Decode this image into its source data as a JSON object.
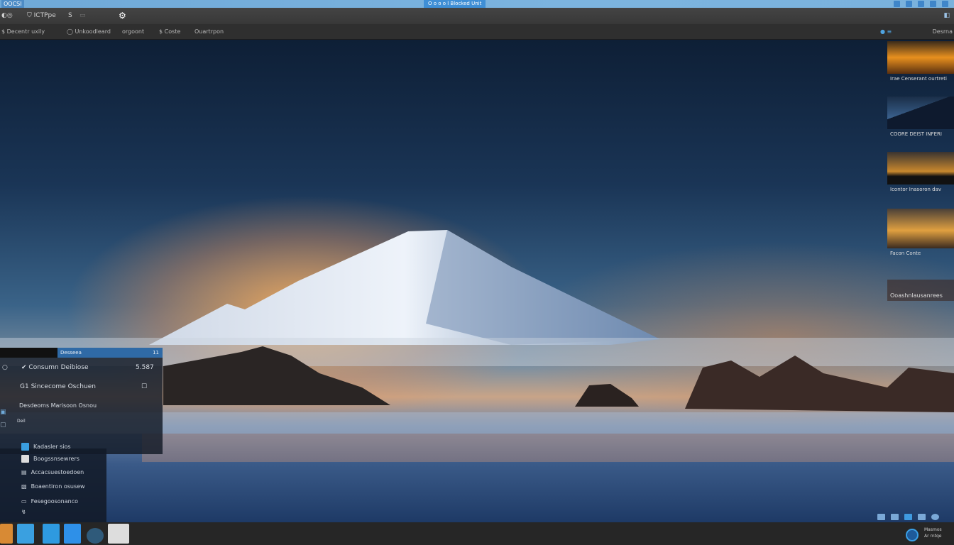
{
  "titlebar": {
    "title": "OOCSI",
    "center": "O o o o l Blocked Unit"
  },
  "toolbar": {
    "item1": "ICTPpe",
    "item2": "S"
  },
  "nav": {
    "items": [
      "Decentr uxily",
      "Unkoodleard",
      "orgoont",
      "Coste",
      "Ouartrpon"
    ],
    "right": "Desrna"
  },
  "thumbnails": [
    {
      "label": "Irae Censerant ourtreti"
    },
    {
      "label": "COORE DEIST INFERI"
    },
    {
      "label": "Icontor Inasoron dav"
    },
    {
      "label": "Facon Conte"
    },
    {
      "label": "Ooashnlausanrees"
    }
  ],
  "panel": {
    "header": "Desseea",
    "header_num": "11",
    "rows": [
      {
        "label": "Consumn Deibiose",
        "value": "5.587"
      },
      {
        "label": "Sincecome Oschuen"
      },
      {
        "label": "Desdeoms Marisoon Osnou"
      },
      {
        "label": "Deil"
      }
    ]
  },
  "submenu": [
    "Kadasler sios",
    "Boogssnsewrers",
    "Accacsuestoedoen",
    "Boaentiron osusew",
    "Fesegoosonanco"
  ],
  "tray": {
    "clock_line1": "Masmos",
    "clock_line2": "Ar rntqe"
  },
  "colors": {
    "accent": "#2f6aa6",
    "titlebar": "#6fa9d8",
    "taskbar": "#262626"
  }
}
